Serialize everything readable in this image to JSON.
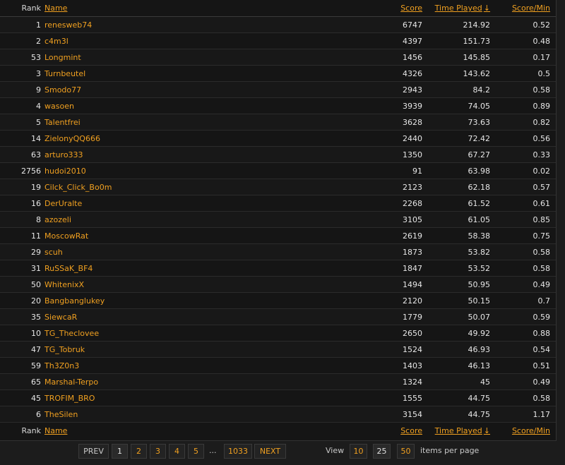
{
  "headers": {
    "rank": "Rank",
    "name": "Name",
    "score": "Score",
    "time_played": "Time Played",
    "sort_arrow": "↓",
    "score_per_min": "Score/Min"
  },
  "rows": [
    {
      "rank": "1",
      "name": "renesweb74",
      "score": "6747",
      "time": "214.92",
      "spm": "0.52"
    },
    {
      "rank": "2",
      "name": "c4m3l",
      "score": "4397",
      "time": "151.73",
      "spm": "0.48"
    },
    {
      "rank": "53",
      "name": "Longmint",
      "score": "1456",
      "time": "145.85",
      "spm": "0.17"
    },
    {
      "rank": "3",
      "name": "Turnbeutel",
      "score": "4326",
      "time": "143.62",
      "spm": "0.5"
    },
    {
      "rank": "9",
      "name": "Smodo77",
      "score": "2943",
      "time": "84.2",
      "spm": "0.58"
    },
    {
      "rank": "4",
      "name": "wasoen",
      "score": "3939",
      "time": "74.05",
      "spm": "0.89"
    },
    {
      "rank": "5",
      "name": "Talentfrei",
      "score": "3628",
      "time": "73.63",
      "spm": "0.82"
    },
    {
      "rank": "14",
      "name": "ZielonyQQ666",
      "score": "2440",
      "time": "72.42",
      "spm": "0.56"
    },
    {
      "rank": "63",
      "name": "arturo333",
      "score": "1350",
      "time": "67.27",
      "spm": "0.33"
    },
    {
      "rank": "2756",
      "name": "hudoi2010",
      "score": "91",
      "time": "63.98",
      "spm": "0.02"
    },
    {
      "rank": "19",
      "name": "Cilck_Click_Bo0m",
      "score": "2123",
      "time": "62.18",
      "spm": "0.57"
    },
    {
      "rank": "16",
      "name": "DerUralte",
      "score": "2268",
      "time": "61.52",
      "spm": "0.61"
    },
    {
      "rank": "8",
      "name": "azozeli",
      "score": "3105",
      "time": "61.05",
      "spm": "0.85"
    },
    {
      "rank": "11",
      "name": "MoscowRat",
      "score": "2619",
      "time": "58.38",
      "spm": "0.75"
    },
    {
      "rank": "29",
      "name": "scuh",
      "score": "1873",
      "time": "53.82",
      "spm": "0.58"
    },
    {
      "rank": "31",
      "name": "RuSSaK_BF4",
      "score": "1847",
      "time": "53.52",
      "spm": "0.58"
    },
    {
      "rank": "50",
      "name": "WhitenixX",
      "score": "1494",
      "time": "50.95",
      "spm": "0.49"
    },
    {
      "rank": "20",
      "name": "Bangbanglukey",
      "score": "2120",
      "time": "50.15",
      "spm": "0.7"
    },
    {
      "rank": "35",
      "name": "SiewcaR",
      "score": "1779",
      "time": "50.07",
      "spm": "0.59"
    },
    {
      "rank": "10",
      "name": "TG_Theclovee",
      "score": "2650",
      "time": "49.92",
      "spm": "0.88"
    },
    {
      "rank": "47",
      "name": "TG_Tobruk",
      "score": "1524",
      "time": "46.93",
      "spm": "0.54"
    },
    {
      "rank": "59",
      "name": "Th3Z0n3",
      "score": "1403",
      "time": "46.13",
      "spm": "0.51"
    },
    {
      "rank": "65",
      "name": "Marshal-Terpo",
      "score": "1324",
      "time": "45",
      "spm": "0.49"
    },
    {
      "rank": "45",
      "name": "TROFIM_BRO",
      "score": "1555",
      "time": "44.75",
      "spm": "0.58"
    },
    {
      "rank": "6",
      "name": "TheSilen",
      "score": "3154",
      "time": "44.75",
      "spm": "1.17"
    }
  ],
  "pager": {
    "prev": "PREV",
    "pages": [
      "1",
      "2",
      "3",
      "4",
      "5"
    ],
    "current_page": "1",
    "dots": "...",
    "last_page": "1033",
    "next": "NEXT",
    "view_label": "View",
    "per_page_options": [
      "10",
      "25",
      "50"
    ],
    "per_page_selected": "25",
    "per_page_suffix": "items per page"
  },
  "colors": {
    "accent": "#f0a020",
    "background": "#151515",
    "text": "#d8d8d8"
  }
}
